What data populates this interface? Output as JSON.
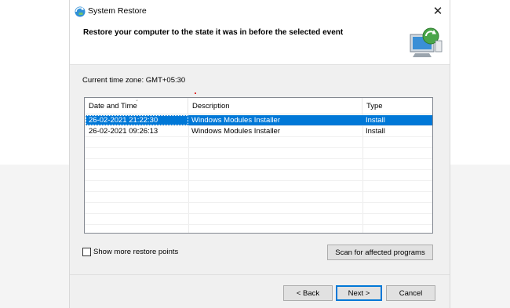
{
  "window": {
    "title": "System Restore"
  },
  "header": {
    "title": "Restore your computer to the state it was in before the selected event"
  },
  "timezone_label": "Current time zone: GMT+05:30",
  "table": {
    "columns": [
      "Date and Time",
      "Description",
      "Type"
    ],
    "rows": [
      {
        "date": "26-02-2021 21:22:30",
        "description": "Windows Modules Installer",
        "type": "Install",
        "selected": true
      },
      {
        "date": "26-02-2021 09:26:13",
        "description": "Windows Modules Installer",
        "type": "Install",
        "selected": false
      }
    ]
  },
  "options": {
    "show_more_label": "Show more restore points",
    "show_more_checked": false
  },
  "buttons": {
    "scan": "Scan for affected programs",
    "back": "< Back",
    "next": "Next >",
    "cancel": "Cancel"
  },
  "icons": {
    "app": "system-restore-icon",
    "header": "restore-computer-icon",
    "close": "close-icon"
  },
  "colors": {
    "selection": "#0078d7",
    "dialog_bg": "#f0f0f0"
  }
}
